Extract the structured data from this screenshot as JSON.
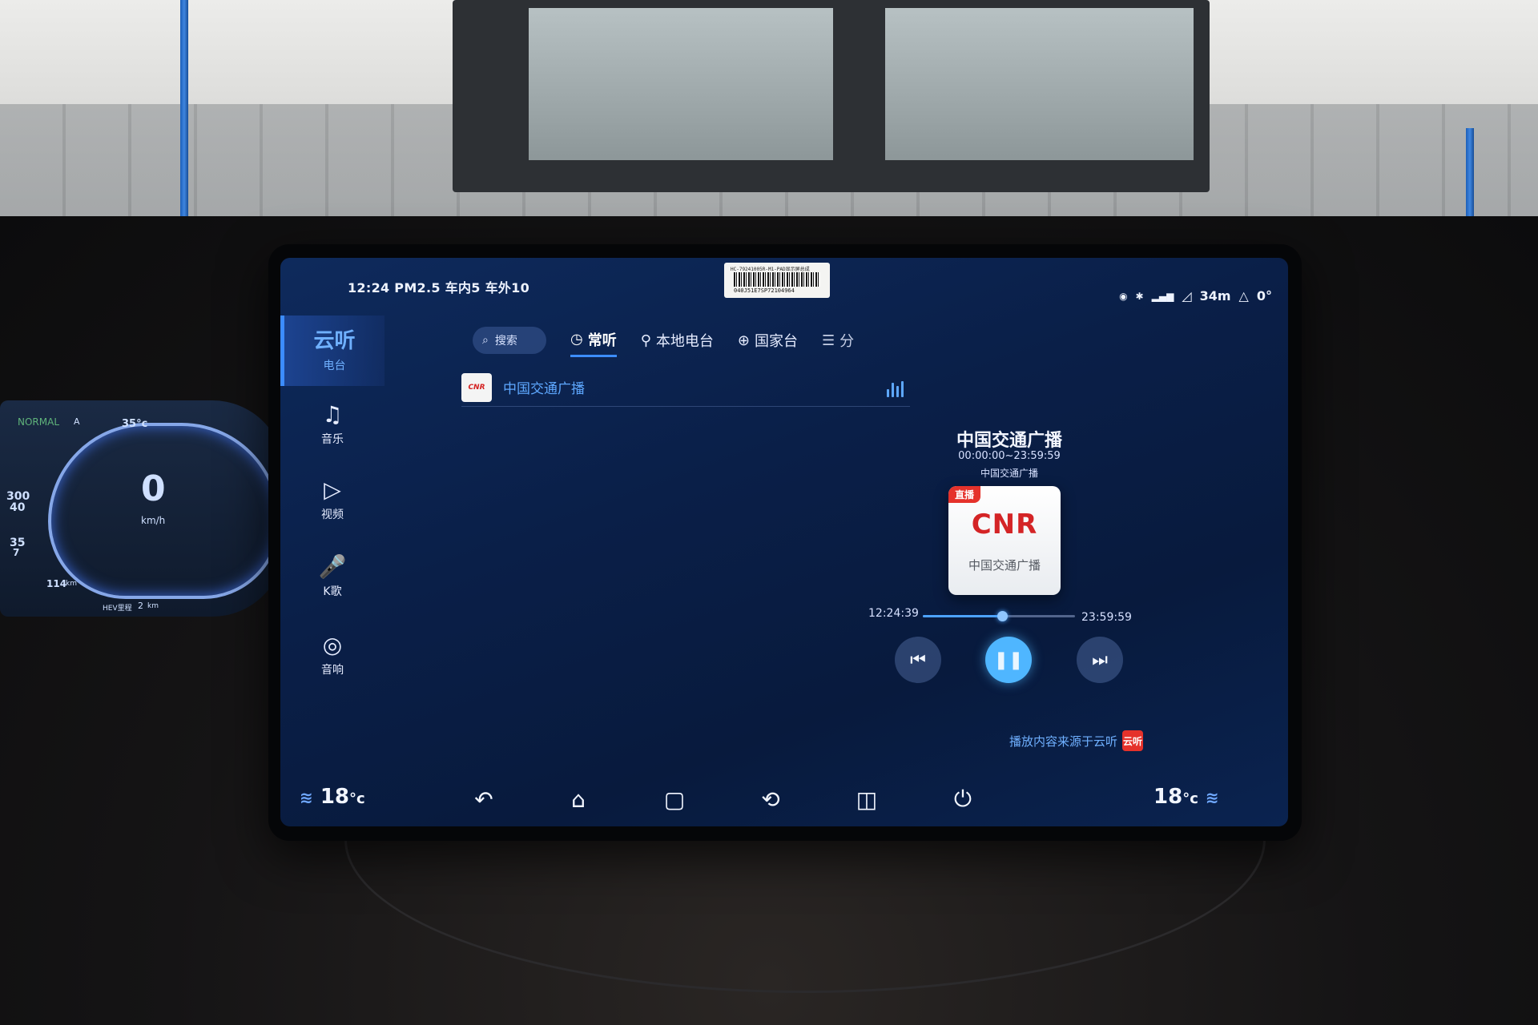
{
  "status_bar": {
    "left_text": "12:24 PM2.5 车内5 车外10",
    "right_text": "34m",
    "right_extra": "0°"
  },
  "sticker": {
    "top_text": "HC-79241005R-M1-PAD显示屏总成",
    "code": "040J51E7SP72104964"
  },
  "sidebar": {
    "items": [
      {
        "icon": "云听",
        "label": "电台",
        "active": true
      },
      {
        "icon": "♫",
        "label": "音乐",
        "active": false
      },
      {
        "icon": "▷",
        "label": "视频",
        "active": false
      },
      {
        "icon": "🎤",
        "label": "K歌",
        "active": false
      },
      {
        "icon": "◎",
        "label": "音响",
        "active": false
      }
    ]
  },
  "tabs": {
    "search_label": "搜索",
    "items": [
      {
        "label": "常听",
        "active": true
      },
      {
        "label": "本地电台",
        "active": false
      },
      {
        "label": "国家台",
        "active": false
      },
      {
        "label": "分",
        "active": false
      }
    ]
  },
  "station_list": [
    {
      "name": "中国交通广播",
      "thumb_text": "CNR"
    }
  ],
  "now_playing": {
    "title": "中国交通广播",
    "schedule": "00:00:00~23:59:59",
    "subtitle": "中国交通广播",
    "live_badge": "直播",
    "cover_logo": "CNR",
    "cover_caption": "中国交通广播",
    "current_time": "12:24:39",
    "end_time": "23:59:59",
    "progress": 0.52,
    "source_text": "播放内容来源于云听",
    "source_badge": "云听"
  },
  "dock": {
    "temp_left": "18",
    "temp_right": "18",
    "temp_unit": "°c"
  },
  "cluster": {
    "mode": "NORMAL",
    "gear": "A",
    "outside_temp": "35°c",
    "speed": "0",
    "speed_unit": "km/h",
    "range": "114",
    "range_unit": "km",
    "hev_label": "HEV里程",
    "hev_value": "2",
    "hev_unit": "km",
    "left_num_1": "300",
    "left_num_2": "40",
    "left_num_3": "35",
    "left_num_4": "7"
  },
  "colors": {
    "accent": "#3d8dff",
    "accent_light": "#5ea8ff",
    "screen_bg": "#0a1f48",
    "live_red": "#e5322b",
    "cnr_red": "#d42426",
    "play_button": "#4fb6ff"
  }
}
